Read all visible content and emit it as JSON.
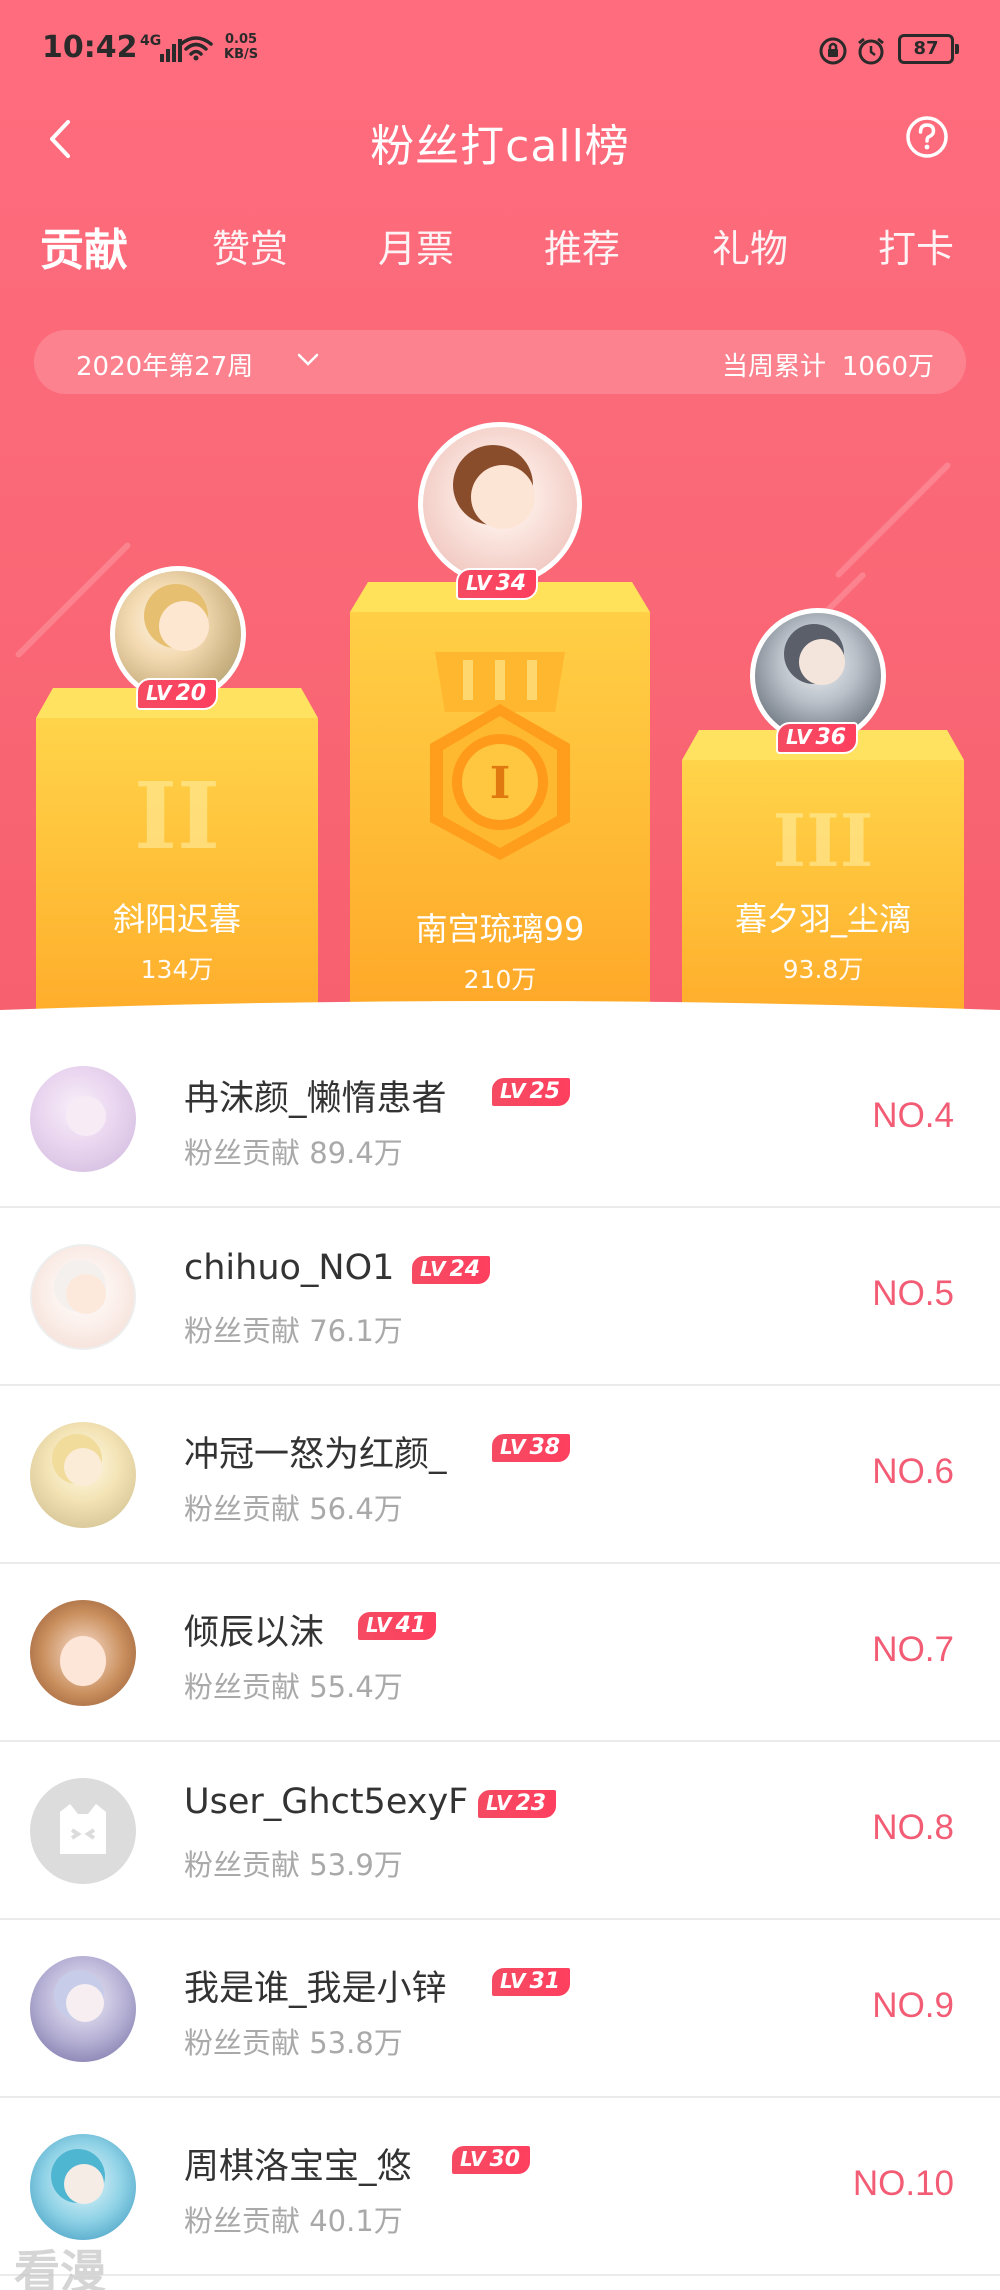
{
  "status": {
    "time": "10:42",
    "network": "4G",
    "speed_value": "0.05",
    "speed_unit": "KB/S",
    "battery": "87"
  },
  "nav": {
    "title": "粉丝打call榜"
  },
  "tabs": [
    {
      "label": "贡献",
      "active": true
    },
    {
      "label": "赞赏",
      "active": false
    },
    {
      "label": "月票",
      "active": false
    },
    {
      "label": "推荐",
      "active": false
    },
    {
      "label": "礼物",
      "active": false
    },
    {
      "label": "打卡",
      "active": false
    }
  ],
  "week": {
    "label": "2020年第27周",
    "total_label": "当周累计",
    "total_value": "1060万"
  },
  "podium": {
    "first": {
      "name": "南宫琉璃99",
      "score": "210万",
      "lv": "34",
      "rank_mark": "I"
    },
    "second": {
      "name": "斜阳迟暮",
      "score": "134万",
      "lv": "20",
      "rank_mark": "II"
    },
    "third": {
      "name": "暮夕羽_尘漓",
      "score": "93.8万",
      "lv": "36",
      "rank_mark": "III"
    }
  },
  "lv_prefix": "LV",
  "list": [
    {
      "name": "冉沫颜_懒惰患者",
      "lv": "25",
      "contrib": "粉丝贡献 89.4万",
      "rank": "NO.4"
    },
    {
      "name": "chihuo_NO1",
      "lv": "24",
      "contrib": "粉丝贡献 76.1万",
      "rank": "NO.5"
    },
    {
      "name": "冲冠一怒为红颜_",
      "lv": "38",
      "contrib": "粉丝贡献 56.4万",
      "rank": "NO.6"
    },
    {
      "name": "倾辰以沫",
      "lv": "41",
      "contrib": "粉丝贡献 55.4万",
      "rank": "NO.7"
    },
    {
      "name": "User_Ghct5exyF",
      "lv": "23",
      "contrib": "粉丝贡献 53.9万",
      "rank": "NO.8"
    },
    {
      "name": "我是谁_我是小锌",
      "lv": "31",
      "contrib": "粉丝贡献 53.8万",
      "rank": "NO.9"
    },
    {
      "name": "周棋洛宝宝_悠",
      "lv": "30",
      "contrib": "粉丝贡献 40.1万",
      "rank": "NO.10"
    }
  ],
  "watermark": "看漫",
  "colors": {
    "header_bg": "#fb6a79",
    "podium_gold": "#ffc23a",
    "rank_text": "#f25c74",
    "lv_badge": "#f54b62"
  },
  "icons": {
    "back": "chevron-left-icon",
    "help": "question-circle-icon",
    "week_dropdown": "chevron-down-icon",
    "medal": "gold-medal-icon"
  }
}
